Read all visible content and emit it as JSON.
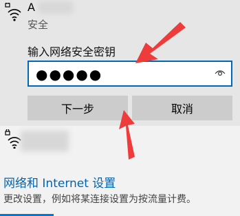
{
  "network": {
    "name_visible": "A",
    "security": "安全",
    "icon": "wifi-secured-icon"
  },
  "password_prompt": {
    "label": "输入网络安全密钥",
    "value": "●●●●●",
    "reveal_icon": "eye-icon"
  },
  "buttons": {
    "next": "下一步",
    "cancel": "取消"
  },
  "second_network": {
    "icon": "wifi-secured-icon"
  },
  "settings": {
    "link": "网络和 Internet 设置",
    "description": "更改设置，例如将某连接设置为按流量计费。"
  },
  "colors": {
    "accent": "#0067b8",
    "annotation_arrow": "#ee3b3b"
  }
}
